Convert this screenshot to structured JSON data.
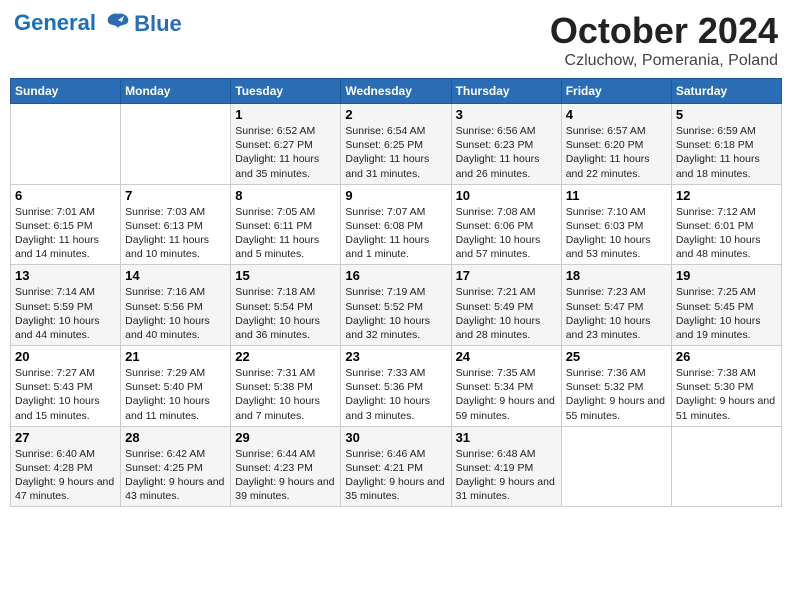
{
  "logo": {
    "line1": "General",
    "line2": "Blue"
  },
  "title": "October 2024",
  "subtitle": "Czluchow, Pomerania, Poland",
  "weekdays": [
    "Sunday",
    "Monday",
    "Tuesday",
    "Wednesday",
    "Thursday",
    "Friday",
    "Saturday"
  ],
  "weeks": [
    [
      {
        "day": "",
        "sunrise": "",
        "sunset": "",
        "daylight": ""
      },
      {
        "day": "",
        "sunrise": "",
        "sunset": "",
        "daylight": ""
      },
      {
        "day": "1",
        "sunrise": "Sunrise: 6:52 AM",
        "sunset": "Sunset: 6:27 PM",
        "daylight": "Daylight: 11 hours and 35 minutes."
      },
      {
        "day": "2",
        "sunrise": "Sunrise: 6:54 AM",
        "sunset": "Sunset: 6:25 PM",
        "daylight": "Daylight: 11 hours and 31 minutes."
      },
      {
        "day": "3",
        "sunrise": "Sunrise: 6:56 AM",
        "sunset": "Sunset: 6:23 PM",
        "daylight": "Daylight: 11 hours and 26 minutes."
      },
      {
        "day": "4",
        "sunrise": "Sunrise: 6:57 AM",
        "sunset": "Sunset: 6:20 PM",
        "daylight": "Daylight: 11 hours and 22 minutes."
      },
      {
        "day": "5",
        "sunrise": "Sunrise: 6:59 AM",
        "sunset": "Sunset: 6:18 PM",
        "daylight": "Daylight: 11 hours and 18 minutes."
      }
    ],
    [
      {
        "day": "6",
        "sunrise": "Sunrise: 7:01 AM",
        "sunset": "Sunset: 6:15 PM",
        "daylight": "Daylight: 11 hours and 14 minutes."
      },
      {
        "day": "7",
        "sunrise": "Sunrise: 7:03 AM",
        "sunset": "Sunset: 6:13 PM",
        "daylight": "Daylight: 11 hours and 10 minutes."
      },
      {
        "day": "8",
        "sunrise": "Sunrise: 7:05 AM",
        "sunset": "Sunset: 6:11 PM",
        "daylight": "Daylight: 11 hours and 5 minutes."
      },
      {
        "day": "9",
        "sunrise": "Sunrise: 7:07 AM",
        "sunset": "Sunset: 6:08 PM",
        "daylight": "Daylight: 11 hours and 1 minute."
      },
      {
        "day": "10",
        "sunrise": "Sunrise: 7:08 AM",
        "sunset": "Sunset: 6:06 PM",
        "daylight": "Daylight: 10 hours and 57 minutes."
      },
      {
        "day": "11",
        "sunrise": "Sunrise: 7:10 AM",
        "sunset": "Sunset: 6:03 PM",
        "daylight": "Daylight: 10 hours and 53 minutes."
      },
      {
        "day": "12",
        "sunrise": "Sunrise: 7:12 AM",
        "sunset": "Sunset: 6:01 PM",
        "daylight": "Daylight: 10 hours and 48 minutes."
      }
    ],
    [
      {
        "day": "13",
        "sunrise": "Sunrise: 7:14 AM",
        "sunset": "Sunset: 5:59 PM",
        "daylight": "Daylight: 10 hours and 44 minutes."
      },
      {
        "day": "14",
        "sunrise": "Sunrise: 7:16 AM",
        "sunset": "Sunset: 5:56 PM",
        "daylight": "Daylight: 10 hours and 40 minutes."
      },
      {
        "day": "15",
        "sunrise": "Sunrise: 7:18 AM",
        "sunset": "Sunset: 5:54 PM",
        "daylight": "Daylight: 10 hours and 36 minutes."
      },
      {
        "day": "16",
        "sunrise": "Sunrise: 7:19 AM",
        "sunset": "Sunset: 5:52 PM",
        "daylight": "Daylight: 10 hours and 32 minutes."
      },
      {
        "day": "17",
        "sunrise": "Sunrise: 7:21 AM",
        "sunset": "Sunset: 5:49 PM",
        "daylight": "Daylight: 10 hours and 28 minutes."
      },
      {
        "day": "18",
        "sunrise": "Sunrise: 7:23 AM",
        "sunset": "Sunset: 5:47 PM",
        "daylight": "Daylight: 10 hours and 23 minutes."
      },
      {
        "day": "19",
        "sunrise": "Sunrise: 7:25 AM",
        "sunset": "Sunset: 5:45 PM",
        "daylight": "Daylight: 10 hours and 19 minutes."
      }
    ],
    [
      {
        "day": "20",
        "sunrise": "Sunrise: 7:27 AM",
        "sunset": "Sunset: 5:43 PM",
        "daylight": "Daylight: 10 hours and 15 minutes."
      },
      {
        "day": "21",
        "sunrise": "Sunrise: 7:29 AM",
        "sunset": "Sunset: 5:40 PM",
        "daylight": "Daylight: 10 hours and 11 minutes."
      },
      {
        "day": "22",
        "sunrise": "Sunrise: 7:31 AM",
        "sunset": "Sunset: 5:38 PM",
        "daylight": "Daylight: 10 hours and 7 minutes."
      },
      {
        "day": "23",
        "sunrise": "Sunrise: 7:33 AM",
        "sunset": "Sunset: 5:36 PM",
        "daylight": "Daylight: 10 hours and 3 minutes."
      },
      {
        "day": "24",
        "sunrise": "Sunrise: 7:35 AM",
        "sunset": "Sunset: 5:34 PM",
        "daylight": "Daylight: 9 hours and 59 minutes."
      },
      {
        "day": "25",
        "sunrise": "Sunrise: 7:36 AM",
        "sunset": "Sunset: 5:32 PM",
        "daylight": "Daylight: 9 hours and 55 minutes."
      },
      {
        "day": "26",
        "sunrise": "Sunrise: 7:38 AM",
        "sunset": "Sunset: 5:30 PM",
        "daylight": "Daylight: 9 hours and 51 minutes."
      }
    ],
    [
      {
        "day": "27",
        "sunrise": "Sunrise: 6:40 AM",
        "sunset": "Sunset: 4:28 PM",
        "daylight": "Daylight: 9 hours and 47 minutes."
      },
      {
        "day": "28",
        "sunrise": "Sunrise: 6:42 AM",
        "sunset": "Sunset: 4:25 PM",
        "daylight": "Daylight: 9 hours and 43 minutes."
      },
      {
        "day": "29",
        "sunrise": "Sunrise: 6:44 AM",
        "sunset": "Sunset: 4:23 PM",
        "daylight": "Daylight: 9 hours and 39 minutes."
      },
      {
        "day": "30",
        "sunrise": "Sunrise: 6:46 AM",
        "sunset": "Sunset: 4:21 PM",
        "daylight": "Daylight: 9 hours and 35 minutes."
      },
      {
        "day": "31",
        "sunrise": "Sunrise: 6:48 AM",
        "sunset": "Sunset: 4:19 PM",
        "daylight": "Daylight: 9 hours and 31 minutes."
      },
      {
        "day": "",
        "sunrise": "",
        "sunset": "",
        "daylight": ""
      },
      {
        "day": "",
        "sunrise": "",
        "sunset": "",
        "daylight": ""
      }
    ]
  ]
}
